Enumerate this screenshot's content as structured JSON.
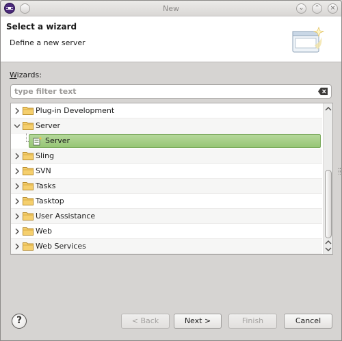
{
  "window": {
    "title": "New"
  },
  "banner": {
    "title": "Select a wizard",
    "description": "Define a new server"
  },
  "wizards_label_first": "W",
  "wizards_label_rest": "izards:",
  "filter": {
    "placeholder": "type filter text",
    "value": ""
  },
  "tree": {
    "items": [
      {
        "label": "Plug-in Development",
        "expanded": false
      },
      {
        "label": "Server",
        "expanded": true
      },
      {
        "label": "Server",
        "child": true,
        "selected": true
      },
      {
        "label": "Sling",
        "expanded": false
      },
      {
        "label": "SVN",
        "expanded": false
      },
      {
        "label": "Tasks",
        "expanded": false
      },
      {
        "label": "Tasktop",
        "expanded": false
      },
      {
        "label": "User Assistance",
        "expanded": false
      },
      {
        "label": "Web",
        "expanded": false
      },
      {
        "label": "Web Services",
        "expanded": false
      }
    ]
  },
  "buttons": {
    "back": "< Back",
    "back_mnemonic": "B",
    "next": "Next >",
    "finish": "Finish",
    "cancel": "Cancel",
    "help": "?"
  },
  "colors": {
    "selection": "#9fcb80",
    "folder": "#e8b449",
    "window_bg": "#d6d4d2"
  }
}
